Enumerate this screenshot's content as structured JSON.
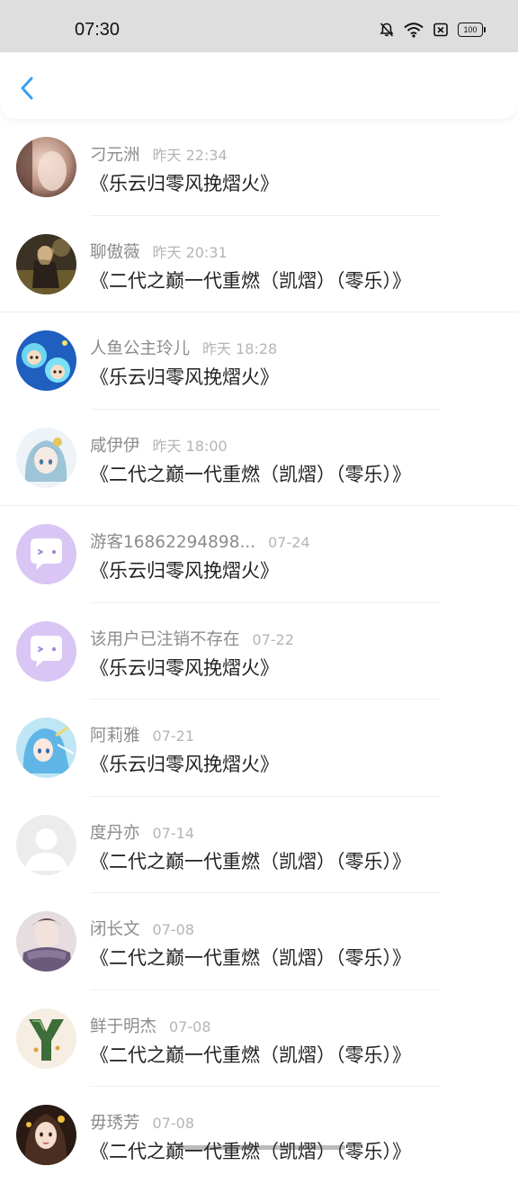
{
  "status_bar": {
    "time": "07:30",
    "battery": "100",
    "icons": [
      "bell-muted-icon",
      "wifi-icon",
      "sim-disabled-icon",
      "battery-icon"
    ]
  },
  "header": {
    "back_icon": "chevron-left-icon",
    "accent_color": "#3a9ff0"
  },
  "items": [
    {
      "name": "刁元洲",
      "time": "昨天 22:34",
      "subject": "《乐云归零风挽熠火》",
      "avatar": "photo-avatar-portrait"
    },
    {
      "name": "聊傲薇",
      "time": "昨天 20:31",
      "subject": "《二代之巅一代重燃（凯熠）（零乐）》",
      "avatar": "photo-avatar-outdoor"
    },
    {
      "name": "人鱼公主玲儿",
      "time": "昨天 18:28",
      "subject": "《乐云归零风挽熠火》",
      "avatar": "anime-avatar-blue"
    },
    {
      "name": "咸伊伊",
      "time": "昨天 18:00",
      "subject": "《二代之巅一代重燃（凯熠）（零乐）》",
      "avatar": "anime-avatar-girl"
    },
    {
      "name": "游客16862294898...",
      "time": "07-24",
      "subject": "《乐云归零风挽熠火》",
      "avatar": "default-chat-avatar"
    },
    {
      "name": "该用户已注销不存在",
      "time": "07-22",
      "subject": "《乐云归零风挽熠火》",
      "avatar": "default-chat-avatar"
    },
    {
      "name": "阿莉雅",
      "time": "07-21",
      "subject": "《乐云归零风挽熠火》",
      "avatar": "anime-avatar-mermaid"
    },
    {
      "name": "度丹亦",
      "time": "07-14",
      "subject": "《二代之巅一代重燃（凯熠）（零乐）》",
      "avatar": "blank-user-avatar"
    },
    {
      "name": "闭长文",
      "time": "07-08",
      "subject": "《二代之巅一代重燃（凯熠）（零乐）》",
      "avatar": "photo-avatar-scarf"
    },
    {
      "name": "鲜于明杰",
      "time": "07-08",
      "subject": "《二代之巅一代重燃（凯熠）（零乐）》",
      "avatar": "letter-y-avatar"
    },
    {
      "name": "毋琇芳",
      "time": "07-08",
      "subject": "《二代之巅一代重燃（凯熠）（零乐）》",
      "avatar": "photo-avatar-girl"
    }
  ]
}
